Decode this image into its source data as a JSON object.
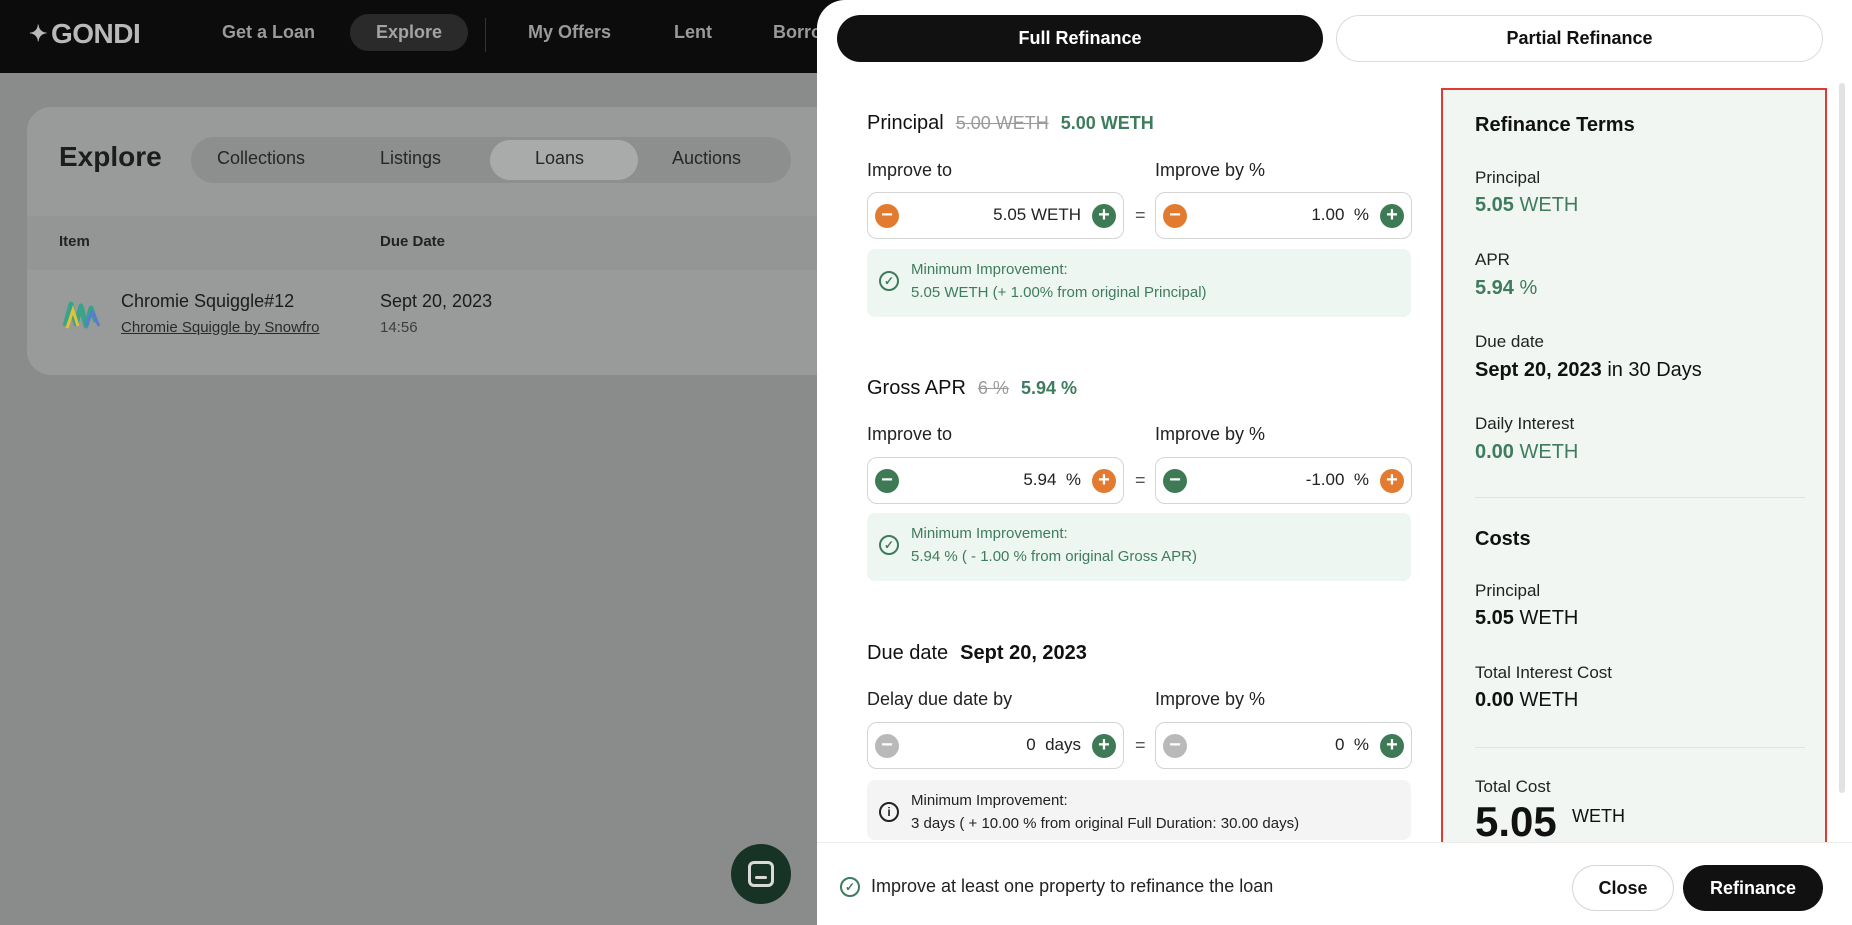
{
  "nav": {
    "logo": "GONDI",
    "items": [
      "Get a Loan",
      "Explore",
      "My Offers",
      "Lent",
      "Borro"
    ]
  },
  "explore": {
    "title": "Explore",
    "tabs": [
      "Collections",
      "Listings",
      "Loans",
      "Auctions"
    ],
    "columns": [
      "Item",
      "Due Date"
    ],
    "row": {
      "name": "Chromie Squiggle#12",
      "collection": "Chromie Squiggle by Snowfro",
      "due_date": "Sept 20, 2023",
      "due_time": "14:56"
    }
  },
  "drawer": {
    "tabs": {
      "full": "Full Refinance",
      "partial": "Partial Refinance"
    },
    "principal": {
      "title": "Principal",
      "old": "5.00 WETH",
      "new": "5.00 WETH",
      "improve_to_label": "Improve to",
      "improve_by_label": "Improve by %",
      "improve_to_value": "5.05 WETH",
      "improve_by_value": "1.00  %",
      "note_title": "Minimum Improvement:",
      "note_body": "5.05 WETH (+ 1.00% from original Principal)"
    },
    "apr": {
      "title": "Gross APR",
      "old": "6 %",
      "new": "5.94 %",
      "improve_to_label": "Improve to",
      "improve_by_label": "Improve by %",
      "improve_to_value": "5.94  %",
      "improve_by_value": "-1.00  %",
      "note_title": "Minimum Improvement:",
      "note_body": "5.94 % ( - 1.00 % from original Gross APR)"
    },
    "due": {
      "title": "Due date",
      "value": "Sept 20, 2023",
      "delay_label": "Delay due date by",
      "improve_by_label": "Improve by %",
      "delay_value": "0  days",
      "improve_by_value": "0  %",
      "note_title": "Minimum Improvement:",
      "note_body": "3 days ( + 10.00 % from original Full Duration: 30.00 days)"
    },
    "equals": "=",
    "summary": {
      "terms_title": "Refinance Terms",
      "principal_label": "Principal",
      "principal_num": "5.05",
      "principal_unit": "WETH",
      "apr_label": "APR",
      "apr_num": "5.94",
      "apr_unit": "%",
      "due_label": "Due date",
      "due_date": "Sept 20, 2023",
      "due_suffix": "in 30 Days",
      "daily_label": "Daily Interest",
      "daily_num": "0.00",
      "daily_unit": "WETH",
      "costs_title": "Costs",
      "cost_principal_label": "Principal",
      "cost_principal_num": "5.05",
      "cost_principal_unit": "WETH",
      "interest_label": "Total Interest Cost",
      "interest_num": "0.00",
      "interest_unit": "WETH",
      "total_label": "Total Cost",
      "total_num": "5.05",
      "total_unit": "WETH"
    },
    "footer": {
      "message": "Improve at least one property to refinance the loan",
      "close": "Close",
      "refinance": "Refinance"
    }
  },
  "colors": {
    "accent_green": "#3e7c5d",
    "accent_orange": "#e27b2f",
    "highlight_red": "#e03a33"
  }
}
